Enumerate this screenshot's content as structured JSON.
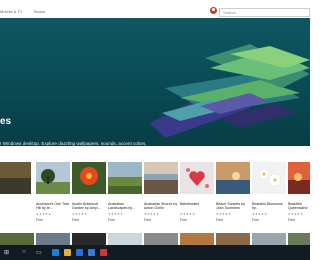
{
  "nav": {
    "movies": "Movies & TV",
    "books": "Books"
  },
  "search": {
    "placeholder": "Search"
  },
  "hero": {
    "title": "es",
    "desc1": "r Windows desktop. Explore dazzling wallpapers, sounds, accent colors,",
    "desc2": "."
  },
  "cards": [
    {
      "title": "",
      "stars": "",
      "price": ""
    },
    {
      "title": "Auckland's One Tree Hill by te...",
      "stars": "★★★★★",
      "price": "Free"
    },
    {
      "title": "Austin Botanical Garden by Amyl...",
      "stars": "★★★★★",
      "price": "Free"
    },
    {
      "title": "Australian Landscapes by...",
      "stars": "★★★★★",
      "price": "Free"
    },
    {
      "title": "Australian Shores by Anton Gorlin",
      "stars": "★★★★★",
      "price": "Free"
    },
    {
      "title": "Babelhearts",
      "stars": "★★★★★",
      "price": "Free"
    },
    {
      "title": "Beach Sunsets by Josh Sommers",
      "stars": "★★★★★",
      "price": "Free"
    },
    {
      "title": "Beautiful Blossoms by...",
      "stars": "★★★★★",
      "price": "Free"
    },
    {
      "title": "Beautiful Queensland by...",
      "stars": "★★★★★",
      "price": "Free"
    },
    {
      "title": "",
      "stars": "",
      "price": ""
    }
  ],
  "colors": {
    "hero": "#0a4a54",
    "taskbar": "#121a24"
  },
  "icons": [
    "windows-icon",
    "search-icon",
    "task-view-icon",
    "edge-icon",
    "folder-icon",
    "store-icon",
    "mail-icon",
    "red-app-icon"
  ]
}
